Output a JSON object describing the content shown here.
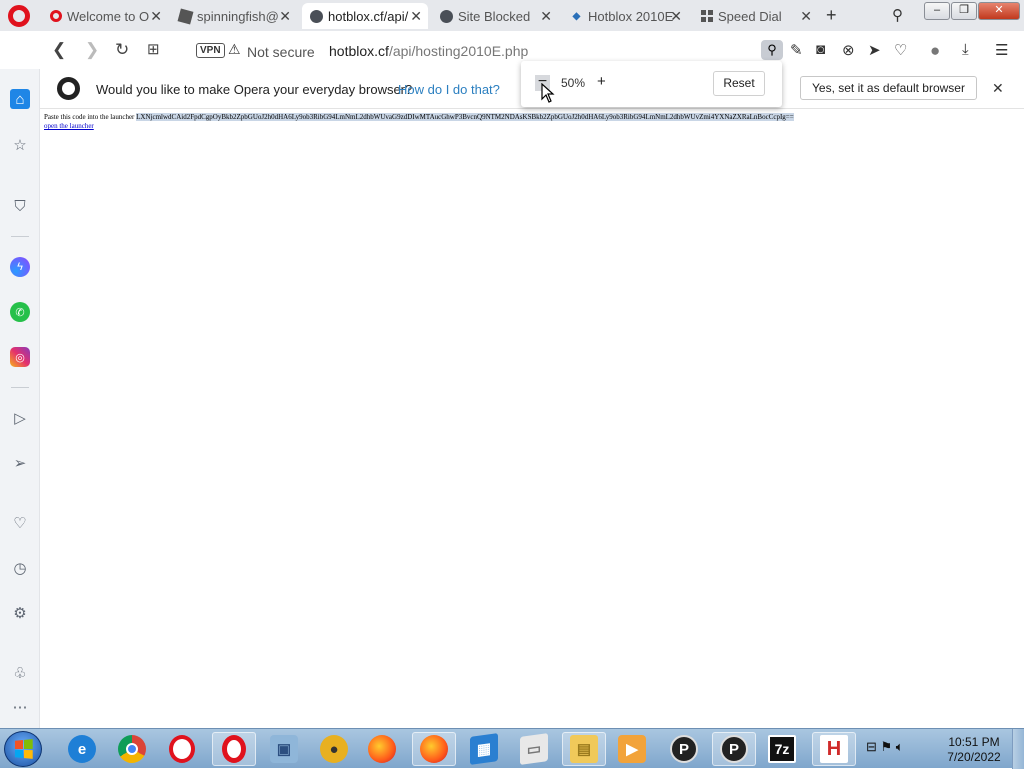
{
  "tabs": [
    {
      "title": "Welcome to O",
      "icon": "opera-icon",
      "active": false
    },
    {
      "title": "spinningfish@",
      "icon": "roblox-icon",
      "active": false
    },
    {
      "title": "hotblox.cf/api/",
      "icon": "globe-icon",
      "active": true
    },
    {
      "title": "Site Blocked",
      "icon": "globe-icon",
      "active": false
    },
    {
      "title": "Hotblox 2010E",
      "icon": "hotblox-icon",
      "active": false
    },
    {
      "title": "Speed Dial",
      "icon": "grid-icon",
      "active": false
    }
  ],
  "address": {
    "vpn_label": "VPN",
    "security": "Not secure",
    "url_host": "hotblox.cf",
    "url_path": "/api/hosting2010E.php"
  },
  "banner": {
    "question": "Would you like to make Opera your everyday browser?",
    "how_link": "How do I do that?",
    "set_default": "Yes, set it as default browser"
  },
  "zoom": {
    "level": "50%",
    "reset": "Reset"
  },
  "page": {
    "paste_label": "Paste this code into the launcher",
    "code": "LXNjcmlwdCAid2FpdCgpOyBkb2ZpbGUoJ2h0dHA6Ly9ob3RibG94LmNmL2dhbWUvaG9zdDIwMTAucGhwP3BvcnQ9NTM2NDAsKSBkb2ZpbGUoJ2h0dHA6Ly9ob3RibG94LmNmL2dhbWUvZmi4YXNaZXRaLnBocCcpIg==",
    "link": "open the launcher"
  },
  "clock": {
    "time": "10:51 PM",
    "date": "7/20/2022"
  },
  "colors": {
    "opera_red": "#e0121d",
    "link_blue": "#2b7fc0",
    "sidebar_active": "#1f86e6"
  }
}
